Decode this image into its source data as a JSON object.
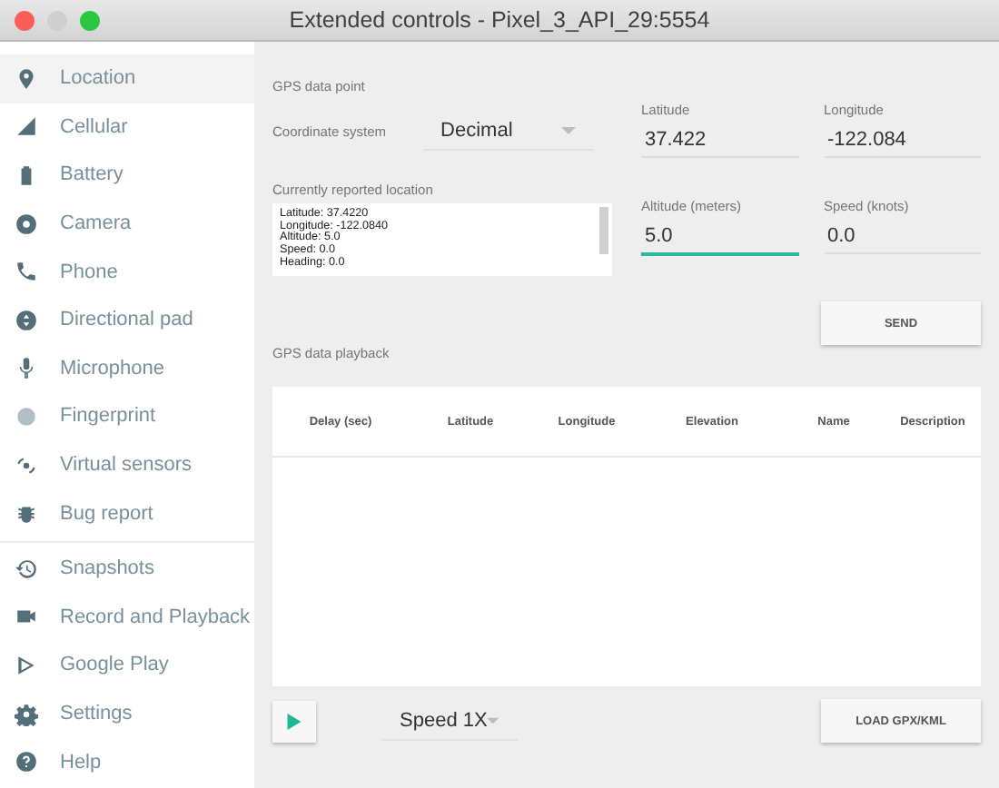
{
  "window": {
    "title": "Extended controls - Pixel_3_API_29:5554"
  },
  "sidebar": {
    "sections": [
      {
        "items": [
          {
            "label": "Location",
            "selected": true
          },
          {
            "label": "Cellular",
            "selected": false
          },
          {
            "label": "Battery",
            "selected": false
          },
          {
            "label": "Camera",
            "selected": false
          },
          {
            "label": "Phone",
            "selected": false
          },
          {
            "label": "Directional pad",
            "selected": false
          },
          {
            "label": "Microphone",
            "selected": false
          },
          {
            "label": "Fingerprint",
            "selected": false
          },
          {
            "label": "Virtual sensors",
            "selected": false
          },
          {
            "label": "Bug report",
            "selected": false
          }
        ]
      },
      {
        "items": [
          {
            "label": "Snapshots",
            "selected": false
          },
          {
            "label": "Record and Playback",
            "selected": false
          },
          {
            "label": "Google Play",
            "selected": false
          },
          {
            "label": "Settings",
            "selected": false
          },
          {
            "label": "Help",
            "selected": false
          }
        ]
      }
    ]
  },
  "gps_point": {
    "title": "GPS data point",
    "coordinate_label": "Coordinate system",
    "coordinate_value": "Decimal",
    "fields": [
      {
        "label": "Latitude",
        "value": "37.422",
        "focused": false
      },
      {
        "label": "Longitude",
        "value": "-122.084",
        "focused": false
      },
      {
        "label": "Altitude (meters)",
        "value": "5.0",
        "focused": true
      },
      {
        "label": "Speed (knots)",
        "value": "0.0",
        "focused": false
      }
    ],
    "reported_label": "Currently reported location",
    "reported_lines": [
      "Latitude: 37.4220",
      "Longitude: -122.0840",
      "Altitude: 5.0",
      "Speed: 0.0",
      "Heading: 0.0"
    ],
    "send_button": "SEND"
  },
  "playback": {
    "title": "GPS data playback",
    "columns": [
      "Delay (sec)",
      "Latitude",
      "Longitude",
      "Elevation",
      "Name",
      "Description"
    ],
    "speed": "Speed 1X",
    "load_button": "LOAD GPX/KML"
  }
}
